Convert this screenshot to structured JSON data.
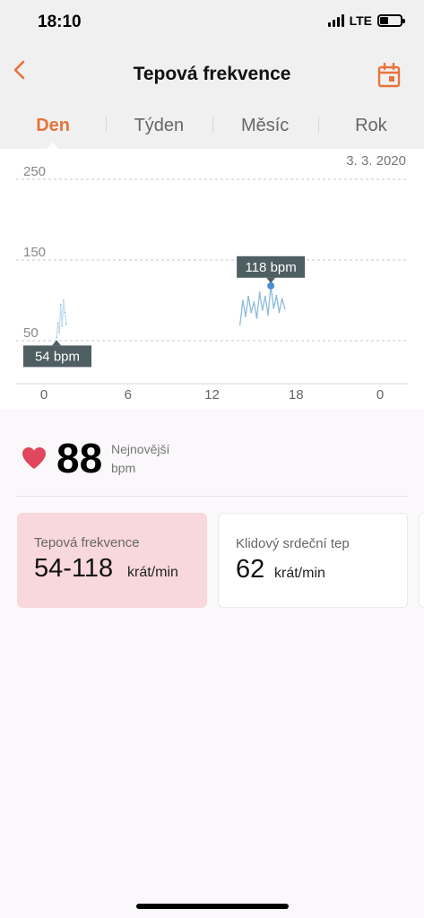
{
  "status_bar": {
    "time": "18:10",
    "network": "LTE"
  },
  "nav": {
    "title": "Tepová frekvence",
    "back_icon": "chevron-left-icon",
    "calendar_icon": "calendar-icon"
  },
  "tabs": [
    {
      "label": "Den",
      "active": true
    },
    {
      "label": "Týden",
      "active": false
    },
    {
      "label": "Měsíc",
      "active": false
    },
    {
      "label": "Rok",
      "active": false
    }
  ],
  "chart": {
    "date": "3. 3. 2020",
    "max_tooltip": "118 bpm",
    "min_tooltip": "54 bpm"
  },
  "chart_data": {
    "type": "line",
    "x": [
      0.9,
      1.0,
      1.1,
      1.2,
      1.3,
      1.4,
      1.5,
      1.6,
      14.0,
      14.2,
      14.4,
      14.6,
      14.8,
      15.0,
      15.2,
      15.4,
      15.6,
      15.8,
      16.0,
      16.2,
      16.4,
      16.6,
      16.8,
      17.0,
      17.2
    ],
    "y": [
      54,
      72,
      60,
      95,
      68,
      100,
      85,
      70,
      70,
      100,
      80,
      105,
      85,
      98,
      78,
      110,
      88,
      105,
      82,
      118,
      90,
      106,
      85,
      102,
      90
    ],
    "yticks": [
      50,
      150,
      250
    ],
    "xticks": [
      "0",
      "6",
      "12",
      "18",
      "0"
    ],
    "xlim": [
      0,
      24
    ],
    "ylim": [
      50,
      250
    ],
    "max_point": {
      "x": 16.2,
      "y": 118,
      "label": "118 bpm"
    },
    "min_point": {
      "x": 0.9,
      "y": 54,
      "label": "54 bpm"
    },
    "grid": true,
    "colors": {
      "line": "#7eb4d8",
      "dot": "#4d8fd6",
      "tooltip_bg": "#4e5e62"
    }
  },
  "summary": {
    "value": "88",
    "label_line1": "Nejnovější",
    "label_line2": "bpm",
    "heart_icon": "heart-icon",
    "heart_color": "#e0475e"
  },
  "cards": [
    {
      "label": "Tepová frekvence",
      "value": "54-118",
      "unit": "krát/min",
      "active": true
    },
    {
      "label": "Klidový srdeční tep",
      "value": "62",
      "unit": "krát/min",
      "active": false
    }
  ],
  "colors": {
    "accent": "#e8733b",
    "active_card": "#f8d8dc"
  }
}
